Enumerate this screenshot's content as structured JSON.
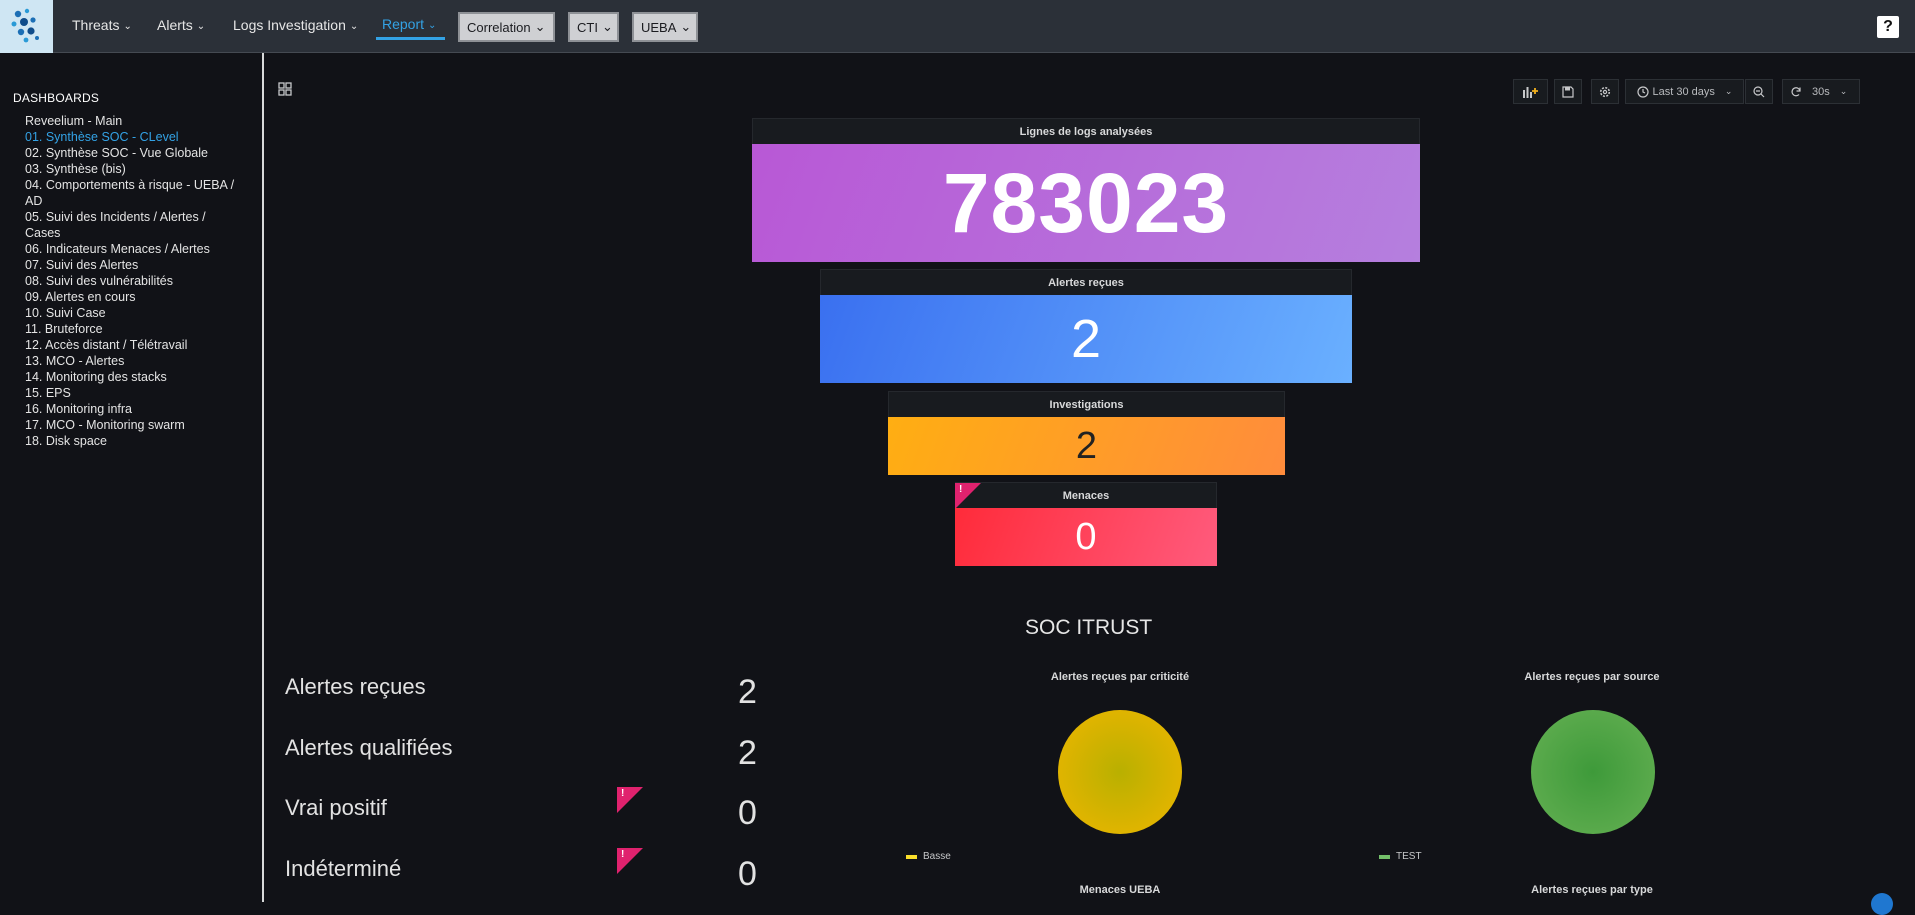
{
  "nav": {
    "items": [
      {
        "label": "Threats"
      },
      {
        "label": "Alerts"
      },
      {
        "label": "Logs Investigation"
      },
      {
        "label": "Report"
      }
    ],
    "buttons": [
      {
        "label": "Correlation"
      },
      {
        "label": "CTI"
      },
      {
        "label": "UEBA"
      }
    ],
    "help": "?"
  },
  "sidebar": {
    "heading": "DASHBOARDS",
    "items": [
      "Reveelium - Main",
      "01. Synthèse SOC - CLevel",
      "02. Synthèse SOC - Vue Globale",
      "03. Synthèse (bis)",
      "04. Comportements à risque - UEBA /",
      "AD",
      "05. Suivi des Incidents / Alertes /",
      "Cases",
      "06. Indicateurs Menaces / Alertes",
      "07. Suivi des Alertes",
      "08. Suivi des vulnérabilités",
      "09. Alertes en cours",
      "10. Suivi Case",
      "11. Bruteforce",
      "12. Accès distant / Télétravail",
      "13. MCO - Alertes",
      "14. Monitoring des stacks",
      "15. EPS",
      "16. Monitoring infra",
      "17. MCO - Monitoring swarm",
      "18. Disk space"
    ],
    "selected_index": 1
  },
  "toolbar": {
    "time_range": "Last 30 days",
    "refresh": "30s"
  },
  "stats": {
    "logs": {
      "title": "Lignes de logs analysées",
      "value": "783023"
    },
    "alertes": {
      "title": "Alertes reçues",
      "value": "2"
    },
    "investigations": {
      "title": "Investigations",
      "value": "2"
    },
    "menaces": {
      "title": "Menaces",
      "value": "0",
      "warning": "!"
    }
  },
  "section": {
    "title": "SOC ITRUST"
  },
  "kpis": [
    {
      "label": "Alertes reçues",
      "value": "2",
      "warning": ""
    },
    {
      "label": "Alertes qualifiées",
      "value": "2",
      "warning": ""
    },
    {
      "label": "Vrai positif",
      "value": "0",
      "warning": "!"
    },
    {
      "label": "Indéterminé",
      "value": "0",
      "warning": "!"
    }
  ],
  "charts": {
    "criticite": {
      "title": "Alertes reçues par criticité",
      "legend": "Basse",
      "color": "#e0b400"
    },
    "source": {
      "title": "Alertes reçues par source",
      "legend": "TEST",
      "color": "#56a64b"
    },
    "menaces_ueba": {
      "title": "Menaces UEBA"
    },
    "type": {
      "title": "Alertes reçues par type"
    }
  },
  "colors": {
    "accent": "#33a2e5",
    "logs_gradient": [
      "#b858d6",
      "#b57fde"
    ],
    "alertes_gradient": [
      "#3a70f0",
      "#6ab0ff"
    ],
    "investigations_gradient": [
      "#ffae12",
      "#ff8c3c"
    ],
    "menaces_gradient": [
      "#ff2b3a",
      "#ff5b7d"
    ]
  }
}
